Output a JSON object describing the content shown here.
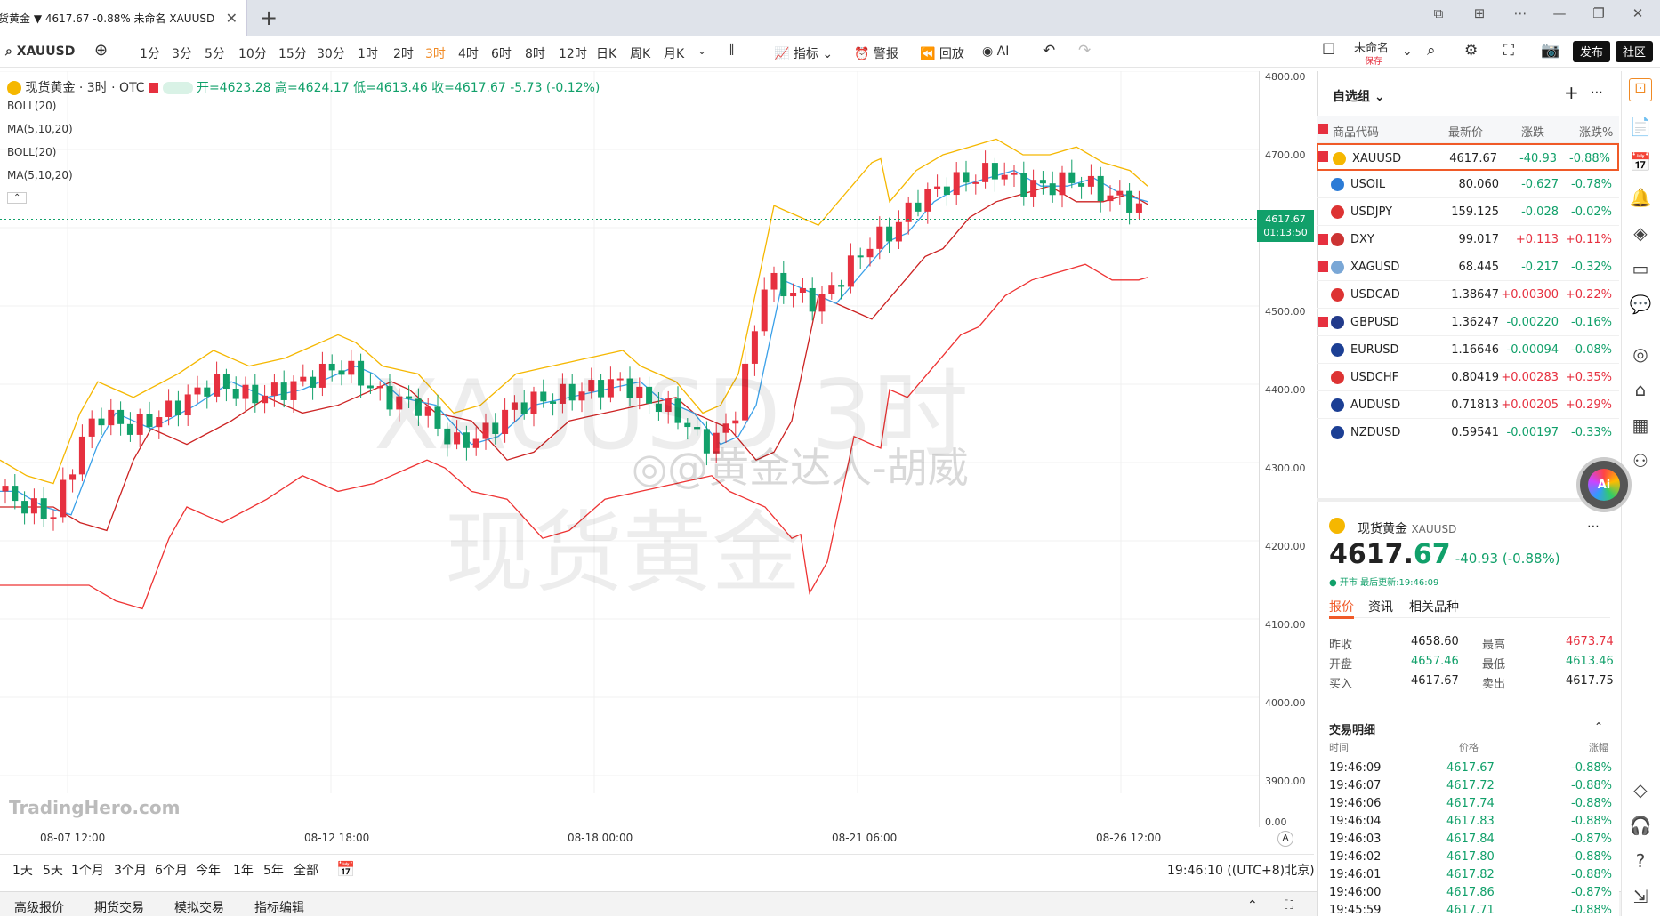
{
  "tab": {
    "title": "货黄金 ▼ 4617.67 -0.88% 未命名 XAUUSD"
  },
  "toolbar": {
    "symbol": "XAUUSD",
    "intervals": [
      "1分",
      "3分",
      "5分",
      "10分",
      "15分",
      "30分",
      "1时",
      "2时",
      "3时",
      "4时",
      "6时",
      "8时",
      "12时",
      "日K",
      "周K",
      "月K"
    ],
    "active_interval": "3时",
    "indicators_label": "指标",
    "alert_label": "警报",
    "replay_label": "回放",
    "ai_label": "AI",
    "layout_name": "未命名",
    "save_label": "保存",
    "publish_label": "发布",
    "community_label": "社区"
  },
  "legend": {
    "title": "现货黄金 · 3时 · OTC",
    "ohlc": "开=4623.28 高=4624.17 低=4613.46 收=4617.67 -5.73 (-0.12%)",
    "indicators": [
      "BOLL(20)",
      "MA(5,10,20)",
      "BOLL(20)",
      "MA(5,10,20)"
    ]
  },
  "watermark": {
    "big": "XAUUSD 3时",
    "sub": "现货黄金",
    "weibo": "@黄金达人-胡威",
    "brand": "TradingHero.com"
  },
  "price_axis": [
    "4800.00",
    "4700.00",
    "4600.00",
    "4500.00",
    "4400.00",
    "4300.00",
    "4200.00",
    "4100.00",
    "4000.00",
    "3900.00",
    "0.00"
  ],
  "last_price": {
    "value": "4617.67",
    "countdown": "01:13:50"
  },
  "time_axis": [
    "08-07 12:00",
    "08-12 18:00",
    "08-18 00:00",
    "08-21 06:00",
    "08-26 12:00"
  ],
  "ranges": [
    "1天",
    "5天",
    "1个月",
    "3个月",
    "6个月",
    "今年",
    "1年",
    "5年",
    "全部"
  ],
  "clock": "19:46:10 ((UTC+8)北京)",
  "bottom": [
    "高级报价",
    "期货交易",
    "模拟交易",
    "指标编辑"
  ],
  "watchlist": {
    "group": "自选组",
    "headers": [
      "商品代码",
      "最新价",
      "涨跌",
      "涨跌%"
    ],
    "rows": [
      {
        "sym": "XAUUSD",
        "last": "4617.67",
        "chg": "-40.93",
        "pct": "-0.88%",
        "flag": true,
        "dir": "down"
      },
      {
        "sym": "USOIL",
        "last": "80.060",
        "chg": "-0.627",
        "pct": "-0.78%",
        "flag": false,
        "dir": "down"
      },
      {
        "sym": "USDJPY",
        "last": "159.125",
        "chg": "-0.028",
        "pct": "-0.02%",
        "flag": false,
        "dir": "down"
      },
      {
        "sym": "DXY",
        "last": "99.017",
        "chg": "+0.113",
        "pct": "+0.11%",
        "flag": true,
        "dir": "up"
      },
      {
        "sym": "XAGUSD",
        "last": "68.445",
        "chg": "-0.217",
        "pct": "-0.32%",
        "flag": true,
        "dir": "down"
      },
      {
        "sym": "USDCAD",
        "last": "1.38647",
        "chg": "+0.00300",
        "pct": "+0.22%",
        "flag": false,
        "dir": "up"
      },
      {
        "sym": "GBPUSD",
        "last": "1.36247",
        "chg": "-0.00220",
        "pct": "-0.16%",
        "flag": true,
        "dir": "down"
      },
      {
        "sym": "EURUSD",
        "last": "1.16646",
        "chg": "-0.00094",
        "pct": "-0.08%",
        "flag": false,
        "dir": "down"
      },
      {
        "sym": "USDCHF",
        "last": "0.80419",
        "chg": "+0.00283",
        "pct": "+0.35%",
        "flag": false,
        "dir": "up"
      },
      {
        "sym": "AUDUSD",
        "last": "0.71813",
        "chg": "+0.00205",
        "pct": "+0.29%",
        "flag": false,
        "dir": "up"
      },
      {
        "sym": "NZDUSD",
        "last": "0.59541",
        "chg": "-0.00197",
        "pct": "-0.33%",
        "flag": false,
        "dir": "down"
      }
    ]
  },
  "detail": {
    "name": "现货黄金",
    "sym": "XAUUSD",
    "price_int": "4617.",
    "price_dec": "67",
    "change": "-40.93 (-0.88%)",
    "status": "● 开市 最后更新:19:46:09",
    "tabs": [
      "报价",
      "资讯",
      "相关品种"
    ],
    "stats": [
      {
        "l1": "昨收",
        "v1": "4658.60",
        "l2": "最高",
        "v2": "4673.74"
      },
      {
        "l1": "开盘",
        "v1": "4657.46",
        "l2": "最低",
        "v2": "4613.46"
      },
      {
        "l1": "买入",
        "v1": "4617.67",
        "l2": "卖出",
        "v2": "4617.75"
      }
    ],
    "trades_title": "交易明细",
    "trade_headers": [
      "时间",
      "价格",
      "涨幅"
    ],
    "trades": [
      {
        "t": "19:46:09",
        "p": "4617.67",
        "c": "-0.88%"
      },
      {
        "t": "19:46:07",
        "p": "4617.72",
        "c": "-0.88%"
      },
      {
        "t": "19:46:06",
        "p": "4617.74",
        "c": "-0.88%"
      },
      {
        "t": "19:46:04",
        "p": "4617.83",
        "c": "-0.88%"
      },
      {
        "t": "19:46:03",
        "p": "4617.84",
        "c": "-0.87%"
      },
      {
        "t": "19:46:02",
        "p": "4617.80",
        "c": "-0.88%"
      },
      {
        "t": "19:46:01",
        "p": "4617.82",
        "c": "-0.88%"
      },
      {
        "t": "19:46:00",
        "p": "4617.86",
        "c": "-0.87%"
      },
      {
        "t": "19:45:59",
        "p": "4617.71",
        "c": "-0.88%"
      }
    ]
  },
  "colors": {
    "up": "#e6303f",
    "down": "#11a06a",
    "accent": "#f08a24"
  }
}
